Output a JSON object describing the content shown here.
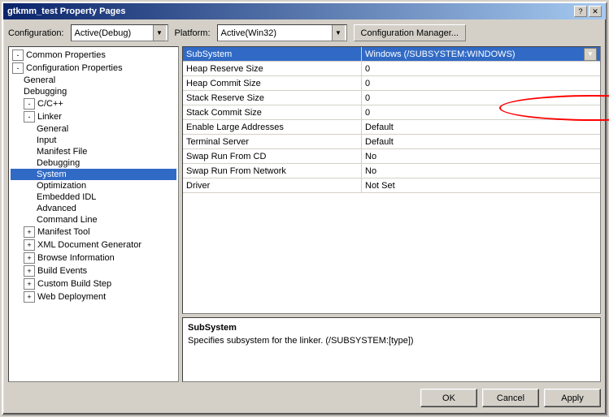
{
  "window": {
    "title": "gtkmm_test Property Pages",
    "title_buttons": [
      "?",
      "X"
    ]
  },
  "config_row": {
    "config_label": "Configuration:",
    "config_value": "Active(Debug)",
    "platform_label": "Platform:",
    "platform_value": "Active(Win32)",
    "manager_btn": "Configuration Manager..."
  },
  "tree": {
    "items": [
      {
        "id": "common-props",
        "label": "Common Properties",
        "level": 0,
        "expanded": true,
        "has_expand": true,
        "is_plus": false
      },
      {
        "id": "config-props",
        "label": "Configuration Properties",
        "level": 0,
        "expanded": true,
        "has_expand": true,
        "is_plus": false
      },
      {
        "id": "general",
        "label": "General",
        "level": 1,
        "has_expand": false
      },
      {
        "id": "debugging",
        "label": "Debugging",
        "level": 1,
        "has_expand": false
      },
      {
        "id": "cpp",
        "label": "C/C++",
        "level": 1,
        "has_expand": true,
        "is_plus": false
      },
      {
        "id": "linker",
        "label": "Linker",
        "level": 1,
        "has_expand": true,
        "is_plus": false
      },
      {
        "id": "linker-general",
        "label": "General",
        "level": 2,
        "has_expand": false
      },
      {
        "id": "input",
        "label": "Input",
        "level": 2,
        "has_expand": false
      },
      {
        "id": "manifest-file",
        "label": "Manifest File",
        "level": 2,
        "has_expand": false
      },
      {
        "id": "debugging2",
        "label": "Debugging",
        "level": 2,
        "has_expand": false
      },
      {
        "id": "system",
        "label": "System",
        "level": 2,
        "has_expand": false,
        "selected": true
      },
      {
        "id": "optimization",
        "label": "Optimization",
        "level": 2,
        "has_expand": false
      },
      {
        "id": "embedded-idl",
        "label": "Embedded IDL",
        "level": 2,
        "has_expand": false
      },
      {
        "id": "advanced",
        "label": "Advanced",
        "level": 2,
        "has_expand": false
      },
      {
        "id": "command-line",
        "label": "Command Line",
        "level": 2,
        "has_expand": false
      },
      {
        "id": "manifest-tool",
        "label": "Manifest Tool",
        "level": 1,
        "has_expand": true,
        "is_plus": true
      },
      {
        "id": "xml-doc-gen",
        "label": "XML Document Generator",
        "level": 1,
        "has_expand": true,
        "is_plus": true
      },
      {
        "id": "browse-info",
        "label": "Browse Information",
        "level": 1,
        "has_expand": true,
        "is_plus": true
      },
      {
        "id": "build-events",
        "label": "Build Events",
        "level": 1,
        "has_expand": true,
        "is_plus": true
      },
      {
        "id": "custom-build",
        "label": "Custom Build Step",
        "level": 1,
        "has_expand": true,
        "is_plus": true
      },
      {
        "id": "web-deploy",
        "label": "Web Deployment",
        "level": 1,
        "has_expand": true,
        "is_plus": true
      }
    ]
  },
  "properties": {
    "rows": [
      {
        "name": "SubSystem",
        "value": "Windows (/SUBSYSTEM:WINDOWS)",
        "selected": true
      },
      {
        "name": "Heap Reserve Size",
        "value": "0",
        "selected": false
      },
      {
        "name": "Heap Commit Size",
        "value": "0",
        "selected": false
      },
      {
        "name": "Stack Reserve Size",
        "value": "0",
        "selected": false
      },
      {
        "name": "Stack Commit Size",
        "value": "0",
        "selected": false
      },
      {
        "name": "Enable Large Addresses",
        "value": "Default",
        "selected": false
      },
      {
        "name": "Terminal Server",
        "value": "Default",
        "selected": false
      },
      {
        "name": "Swap Run From CD",
        "value": "No",
        "selected": false
      },
      {
        "name": "Swap Run From Network",
        "value": "No",
        "selected": false
      },
      {
        "name": "Driver",
        "value": "Not Set",
        "selected": false
      }
    ]
  },
  "description": {
    "title": "SubSystem",
    "text": "Specifies subsystem for the linker.  (/SUBSYSTEM:[type])"
  },
  "buttons": {
    "ok": "OK",
    "cancel": "Cancel",
    "apply": "Apply"
  },
  "colors": {
    "selected_bg": "#316ac5",
    "title_gradient_start": "#0a246a",
    "title_gradient_end": "#a6caf0",
    "window_bg": "#d4d0c8"
  }
}
